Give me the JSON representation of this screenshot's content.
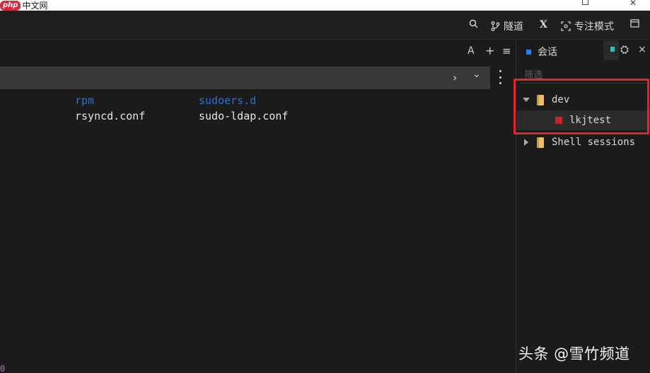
{
  "watermark_top": {
    "php": "php",
    "site": "中文网"
  },
  "toolbar": {
    "search_icon": "search-icon",
    "tunnel_label": "隧道",
    "x_label": "X",
    "focus_label": "专注模式",
    "layout_icon": "layout-icon"
  },
  "terminal_tabs": {
    "font_label": "A",
    "add_label": "+",
    "menu_label": "≡"
  },
  "strip": {
    "chevron_right": "›",
    "chevron_down": "⌄"
  },
  "terminal": {
    "rows": [
      [
        {
          "text": "rpm",
          "kind": "dir"
        },
        {
          "text": "sudoers.d",
          "kind": "dir"
        }
      ],
      [
        {
          "text": "rsyncd.conf",
          "kind": "file"
        },
        {
          "text": "sudo-ldap.conf",
          "kind": "file"
        }
      ]
    ],
    "bottom_fragment": "0"
  },
  "sidebar": {
    "tab_label": "会话",
    "gear_label": "⛭",
    "close_label": "×",
    "filter_placeholder": "筛选",
    "tree": {
      "dev_label": "dev",
      "session_label": "lkjtest",
      "shell_label": "Shell sessions"
    }
  },
  "watermark_bottom": "头条 @雪竹频道"
}
